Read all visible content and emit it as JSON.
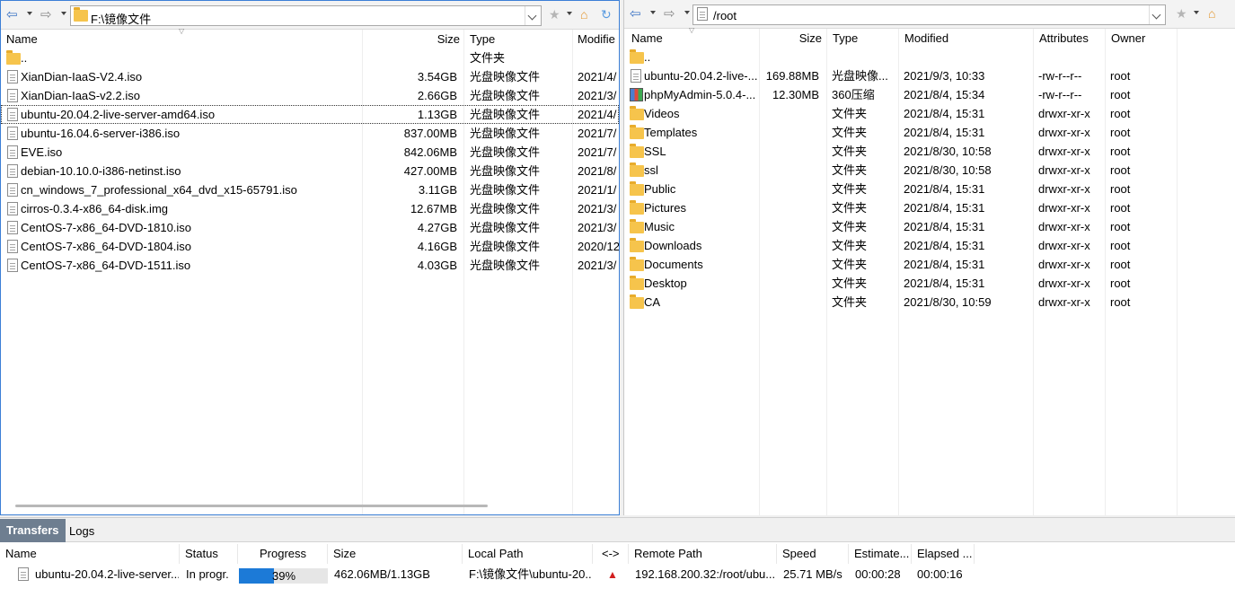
{
  "left": {
    "path": "F:\\镜像文件",
    "columns": [
      "Name",
      "Size",
      "Type",
      "Modifie"
    ],
    "files": [
      {
        "name": "..",
        "size": "",
        "type": "文件夹",
        "modified": "",
        "icon": "folder-icon"
      },
      {
        "name": "XianDian-IaaS-V2.4.iso",
        "size": "3.54GB",
        "type": "光盘映像文件",
        "modified": "2021/4/",
        "icon": "file-icon"
      },
      {
        "name": "XianDian-IaaS-v2.2.iso",
        "size": "2.66GB",
        "type": "光盘映像文件",
        "modified": "2021/3/",
        "icon": "file-icon"
      },
      {
        "name": "ubuntu-20.04.2-live-server-amd64.iso",
        "size": "1.13GB",
        "type": "光盘映像文件",
        "modified": "2021/4/",
        "icon": "file-icon",
        "selected": true
      },
      {
        "name": "ubuntu-16.04.6-server-i386.iso",
        "size": "837.00MB",
        "type": "光盘映像文件",
        "modified": "2021/7/",
        "icon": "file-icon"
      },
      {
        "name": "EVE.iso",
        "size": "842.06MB",
        "type": "光盘映像文件",
        "modified": "2021/7/",
        "icon": "file-icon"
      },
      {
        "name": "debian-10.10.0-i386-netinst.iso",
        "size": "427.00MB",
        "type": "光盘映像文件",
        "modified": "2021/8/",
        "icon": "file-icon"
      },
      {
        "name": "cn_windows_7_professional_x64_dvd_x15-65791.iso",
        "size": "3.11GB",
        "type": "光盘映像文件",
        "modified": "2021/1/",
        "icon": "file-icon"
      },
      {
        "name": "cirros-0.3.4-x86_64-disk.img",
        "size": "12.67MB",
        "type": "光盘映像文件",
        "modified": "2021/3/",
        "icon": "file-icon"
      },
      {
        "name": "CentOS-7-x86_64-DVD-1810.iso",
        "size": "4.27GB",
        "type": "光盘映像文件",
        "modified": "2021/3/",
        "icon": "file-icon"
      },
      {
        "name": "CentOS-7-x86_64-DVD-1804.iso",
        "size": "4.16GB",
        "type": "光盘映像文件",
        "modified": "2020/12",
        "icon": "file-icon"
      },
      {
        "name": "CentOS-7-x86_64-DVD-1511.iso",
        "size": "4.03GB",
        "type": "光盘映像文件",
        "modified": "2021/3/",
        "icon": "file-icon"
      }
    ]
  },
  "right": {
    "path": "/root",
    "columns": [
      "Name",
      "Size",
      "Type",
      "Modified",
      "Attributes",
      "Owner"
    ],
    "files": [
      {
        "name": "..",
        "size": "",
        "type": "",
        "modified": "",
        "attributes": "",
        "owner": "",
        "icon": "folder-icon"
      },
      {
        "name": "ubuntu-20.04.2-live-...",
        "size": "169.88MB",
        "type": "光盘映像...",
        "modified": "2021/9/3, 10:33",
        "attributes": "-rw-r--r--",
        "owner": "root",
        "icon": "file-icon"
      },
      {
        "name": "phpMyAdmin-5.0.4-...",
        "size": "12.30MB",
        "type": "360压缩",
        "modified": "2021/8/4, 15:34",
        "attributes": "-rw-r--r--",
        "owner": "root",
        "icon": "archive-icon"
      },
      {
        "name": "Videos",
        "size": "",
        "type": "文件夹",
        "modified": "2021/8/4, 15:31",
        "attributes": "drwxr-xr-x",
        "owner": "root",
        "icon": "folder-icon"
      },
      {
        "name": "Templates",
        "size": "",
        "type": "文件夹",
        "modified": "2021/8/4, 15:31",
        "attributes": "drwxr-xr-x",
        "owner": "root",
        "icon": "folder-icon"
      },
      {
        "name": "SSL",
        "size": "",
        "type": "文件夹",
        "modified": "2021/8/30, 10:58",
        "attributes": "drwxr-xr-x",
        "owner": "root",
        "icon": "folder-icon"
      },
      {
        "name": "ssl",
        "size": "",
        "type": "文件夹",
        "modified": "2021/8/30, 10:58",
        "attributes": "drwxr-xr-x",
        "owner": "root",
        "icon": "folder-icon"
      },
      {
        "name": "Public",
        "size": "",
        "type": "文件夹",
        "modified": "2021/8/4, 15:31",
        "attributes": "drwxr-xr-x",
        "owner": "root",
        "icon": "folder-icon"
      },
      {
        "name": "Pictures",
        "size": "",
        "type": "文件夹",
        "modified": "2021/8/4, 15:31",
        "attributes": "drwxr-xr-x",
        "owner": "root",
        "icon": "folder-icon"
      },
      {
        "name": "Music",
        "size": "",
        "type": "文件夹",
        "modified": "2021/8/4, 15:31",
        "attributes": "drwxr-xr-x",
        "owner": "root",
        "icon": "folder-icon"
      },
      {
        "name": "Downloads",
        "size": "",
        "type": "文件夹",
        "modified": "2021/8/4, 15:31",
        "attributes": "drwxr-xr-x",
        "owner": "root",
        "icon": "folder-icon"
      },
      {
        "name": "Documents",
        "size": "",
        "type": "文件夹",
        "modified": "2021/8/4, 15:31",
        "attributes": "drwxr-xr-x",
        "owner": "root",
        "icon": "folder-icon"
      },
      {
        "name": "Desktop",
        "size": "",
        "type": "文件夹",
        "modified": "2021/8/4, 15:31",
        "attributes": "drwxr-xr-x",
        "owner": "root",
        "icon": "folder-icon"
      },
      {
        "name": "CA",
        "size": "",
        "type": "文件夹",
        "modified": "2021/8/30, 10:59",
        "attributes": "drwxr-xr-x",
        "owner": "root",
        "icon": "folder-icon"
      }
    ]
  },
  "transfers": {
    "tabs": [
      "Transfers",
      "Logs"
    ],
    "columns": [
      "Name",
      "Status",
      "Progress",
      "Size",
      "Local Path",
      "<->",
      "Remote Path",
      "Speed",
      "Estimate...",
      "Elapsed ..."
    ],
    "row": {
      "name": "ubuntu-20.04.2-live-server...",
      "status": "In progr.",
      "progress_percent": 39,
      "progress_label": "39%",
      "size": "462.06MB/1.13GB",
      "local_path": "F:\\镜像文件\\ubuntu-20...",
      "direction_icon": "upload-arrow-icon",
      "remote_path": "192.168.200.32:/root/ubu...",
      "speed": "25.71 MB/s",
      "estimate": "00:00:28",
      "elapsed": "00:00:16"
    }
  },
  "colors": {
    "accent": "#3c7fd6",
    "progress": "#1c7ad7",
    "active_tab": "#6e7e90",
    "folder": "#f6c44c",
    "upload_arrow": "#d21f1f"
  }
}
